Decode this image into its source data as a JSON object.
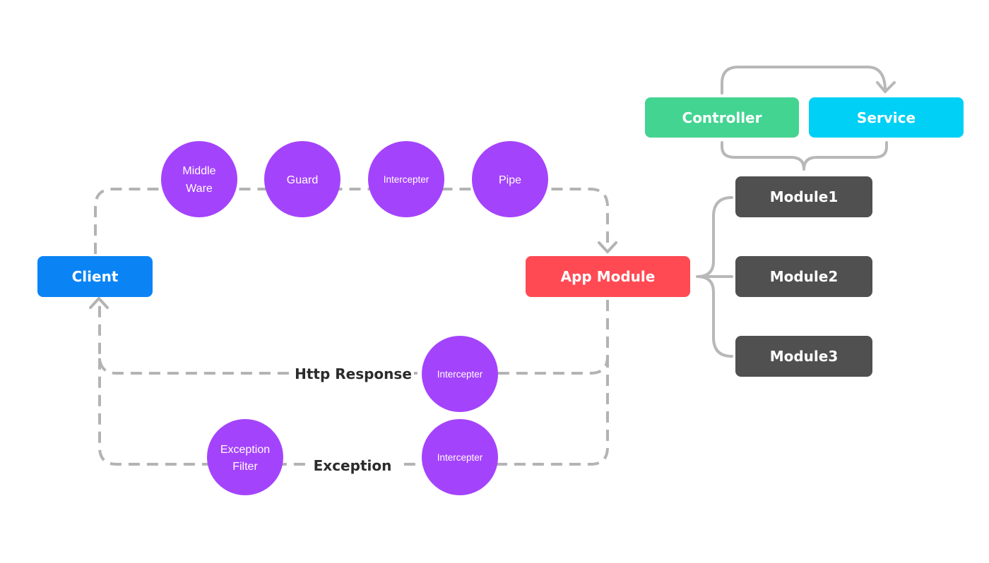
{
  "nodes": {
    "client": {
      "label": "Client",
      "color": "#0A84F5"
    },
    "app_module": {
      "label": "App Module",
      "color": "#FF4A54"
    },
    "controller": {
      "label": "Controller",
      "color": "#43D492"
    },
    "service": {
      "label": "Service",
      "color": "#00D0F5"
    },
    "modules": [
      {
        "label": "Module1",
        "color": "#505050"
      },
      {
        "label": "Module2",
        "color": "#505050"
      },
      {
        "label": "Module3",
        "color": "#505050"
      }
    ]
  },
  "request_pipeline": [
    {
      "line1": "Middle",
      "line2": "Ware"
    },
    {
      "line1": "Guard"
    },
    {
      "line1": "Intercepter"
    },
    {
      "line1": "Pipe"
    }
  ],
  "response_flow": {
    "label": "Http Response",
    "step": "Intercepter"
  },
  "exception_flow": {
    "label": "Exception",
    "filter_line1": "Exception",
    "filter_line2": "Filter",
    "step": "Intercepter"
  },
  "colors": {
    "step_circle": "#A443FC",
    "connector": "#B3B3B3"
  }
}
